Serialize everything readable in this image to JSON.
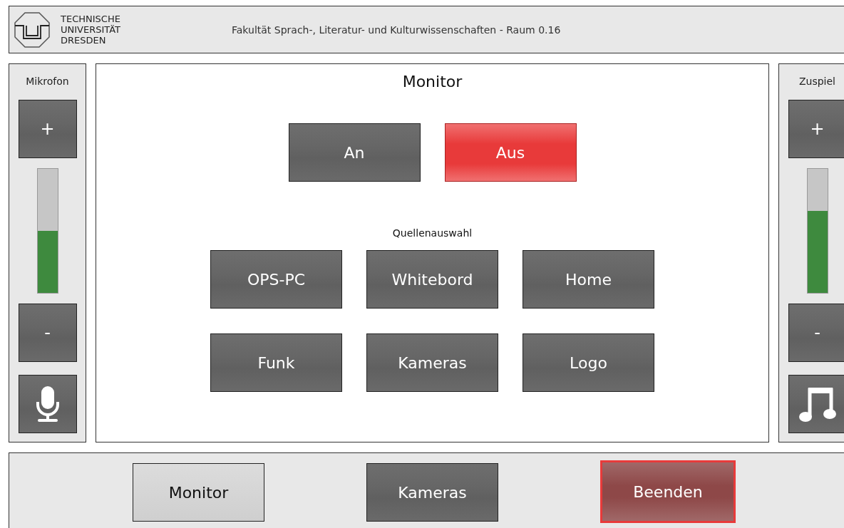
{
  "header": {
    "logo_lines": [
      "TECHNISCHE",
      "UNIVERSITÄT",
      "DRESDEN"
    ],
    "title": "Fakultät Sprach-, Literatur- und Kulturwissenschaften - Raum 0.16"
  },
  "left_panel": {
    "title": "Mikrofon",
    "plus": "+",
    "minus": "-",
    "level": 0.5
  },
  "main": {
    "title": "Monitor",
    "power": [
      {
        "label": "An",
        "selected": false
      },
      {
        "label": "Aus",
        "selected": true
      }
    ],
    "source_title": "Quellenauswahl",
    "sources": [
      "OPS-PC",
      "Whitebord",
      "Home",
      "Funk",
      "Kameras",
      "Logo"
    ]
  },
  "right_panel": {
    "title": "Zuspiel",
    "plus": "+",
    "minus": "-",
    "level": 0.66
  },
  "nav": [
    {
      "label": "Monitor",
      "kind": "page",
      "selected": true
    },
    {
      "label": "Kameras",
      "kind": "page",
      "selected": false
    },
    {
      "label": "Beenden",
      "kind": "exit",
      "selected": false
    }
  ]
}
